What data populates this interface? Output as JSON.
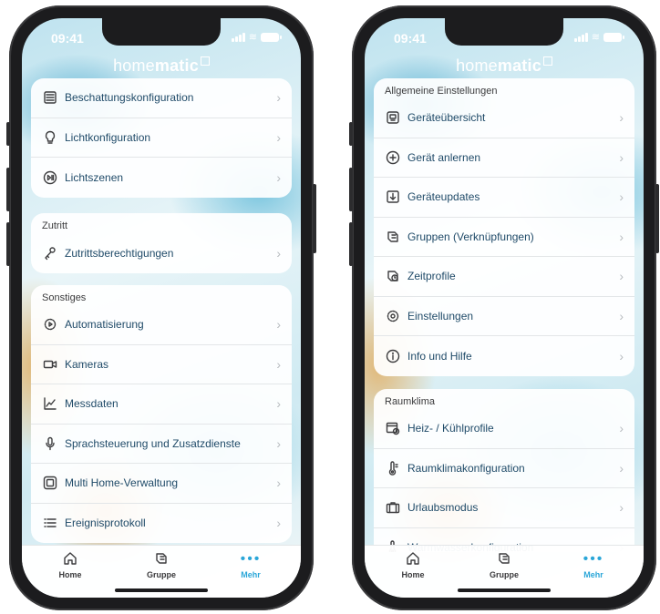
{
  "left": {
    "status_time": "09:41",
    "logo": {
      "a": "home",
      "b": "matic"
    },
    "cards": [
      {
        "header": "",
        "items": [
          {
            "label": "Beschattungskonfiguration",
            "icon": "blinds-icon"
          },
          {
            "label": "Lichtkonfiguration",
            "icon": "lightbulb-icon"
          },
          {
            "label": "Lichtszenen",
            "icon": "play-pause-icon"
          }
        ]
      },
      {
        "header": "Zutritt",
        "items": [
          {
            "label": "Zutrittsberechtigungen",
            "icon": "key-icon"
          }
        ]
      },
      {
        "header": "Sonstiges",
        "items": [
          {
            "label": "Automatisierung",
            "icon": "gear-play-icon"
          },
          {
            "label": "Kameras",
            "icon": "camera-icon"
          },
          {
            "label": "Messdaten",
            "icon": "chart-icon"
          },
          {
            "label": "Sprachsteuerung und Zusatzdienste",
            "icon": "microphone-icon"
          },
          {
            "label": "Multi Home-Verwaltung",
            "icon": "square-icon"
          },
          {
            "label": "Ereignisprotokoll",
            "icon": "list-icon"
          }
        ]
      }
    ],
    "tabs": [
      {
        "label": "Home",
        "icon": "house-icon"
      },
      {
        "label": "Gruppe",
        "icon": "group-icon"
      },
      {
        "label": "Mehr",
        "icon": "more-dots-icon"
      }
    ]
  },
  "right": {
    "status_time": "09:41",
    "logo": {
      "a": "home",
      "b": "matic"
    },
    "cards": [
      {
        "header": "Allgemeine Einstellungen",
        "items": [
          {
            "label": "Geräteübersicht",
            "icon": "device-icon"
          },
          {
            "label": "Gerät anlernen",
            "icon": "plus-circle-icon"
          },
          {
            "label": "Geräteupdates",
            "icon": "download-icon"
          },
          {
            "label": "Gruppen (Verknüpfungen)",
            "icon": "group-link-icon"
          },
          {
            "label": "Zeitprofile",
            "icon": "clock-profile-icon"
          },
          {
            "label": "Einstellungen",
            "icon": "gear-icon"
          },
          {
            "label": "Info und Hilfe",
            "icon": "info-icon"
          }
        ]
      },
      {
        "header": "Raumklima",
        "items": [
          {
            "label": "Heiz- / Kühlprofile",
            "icon": "calendar-clock-icon"
          },
          {
            "label": "Raumklimakonfiguration",
            "icon": "thermometer-icon"
          },
          {
            "label": "Urlaubsmodus",
            "icon": "suitcase-icon"
          },
          {
            "label": "Warmwasserkonfiguration",
            "icon": "thermometer-water-icon"
          }
        ]
      }
    ],
    "tabs": [
      {
        "label": "Home",
        "icon": "house-icon"
      },
      {
        "label": "Gruppe",
        "icon": "group-icon"
      },
      {
        "label": "Mehr",
        "icon": "more-dots-icon"
      }
    ]
  },
  "colors": {
    "accent": "#2aa6d8",
    "label": "#1f4a68"
  }
}
